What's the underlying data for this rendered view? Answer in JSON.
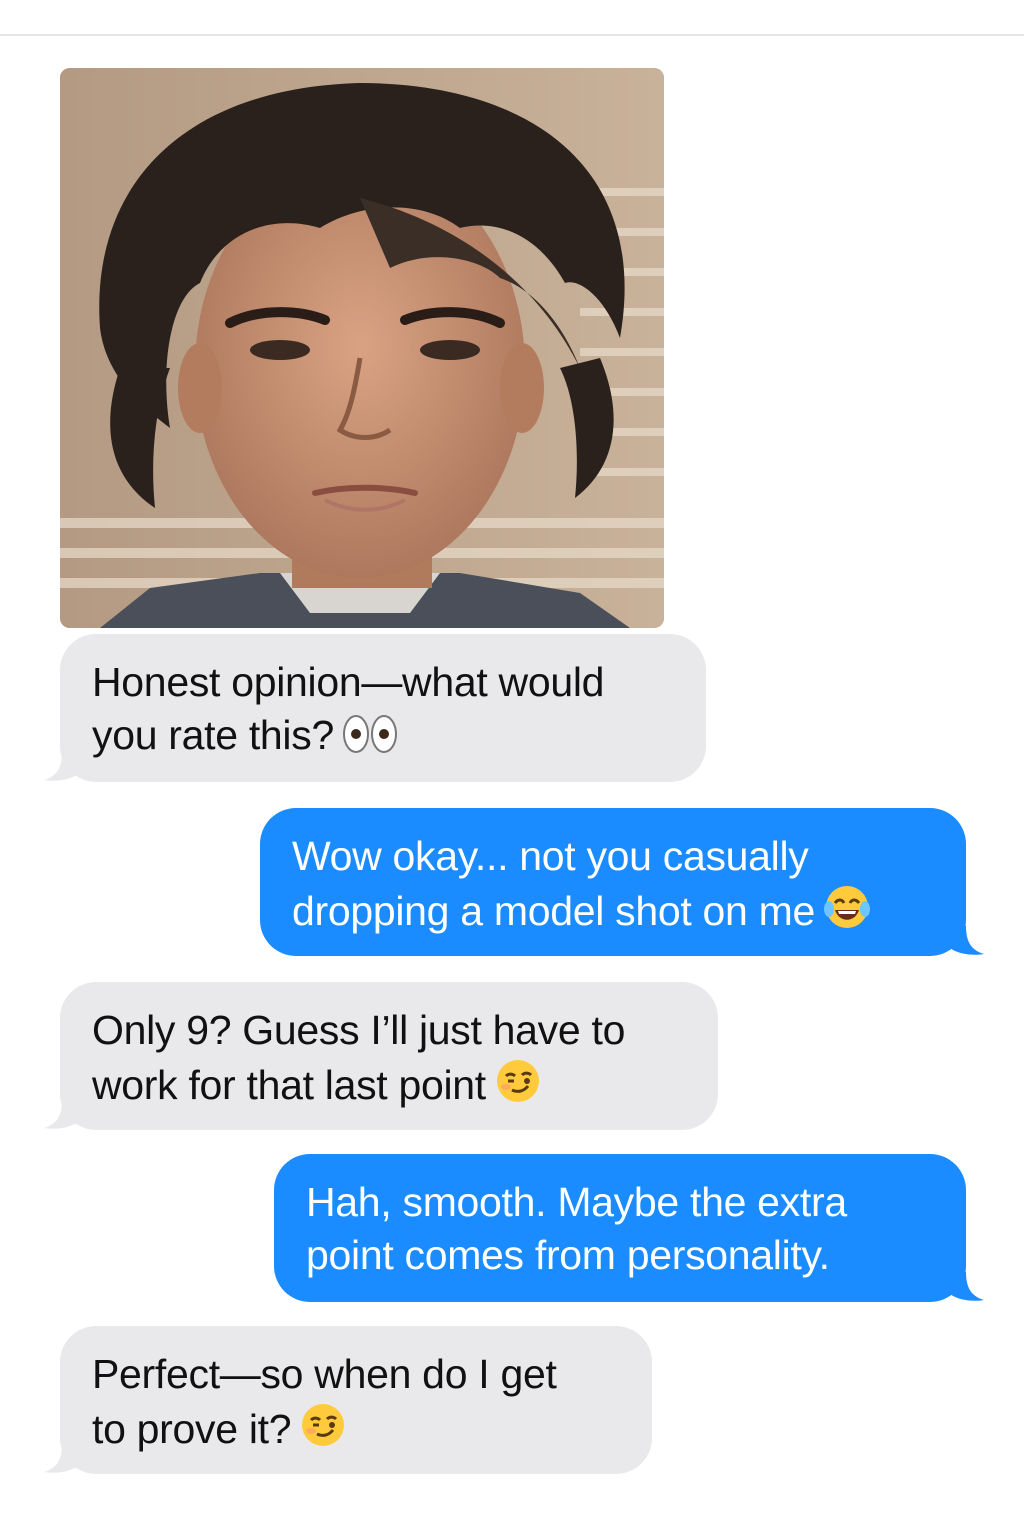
{
  "conversation": {
    "photo_attachment": {
      "description_icon": "portrait-photo-icon"
    },
    "messages": [
      {
        "direction": "received",
        "lines": [
          "Honest opinion—what would",
          "you rate this?"
        ],
        "emoji": "eyes-emoji"
      },
      {
        "direction": "sent",
        "lines": [
          "Wow okay... not you casually",
          "dropping a model shot on me"
        ],
        "emoji": "tears-of-joy-emoji"
      },
      {
        "direction": "received",
        "lines": [
          "Only 9? Guess I’ll just have to",
          "work for that last point"
        ],
        "emoji": "smirk-emoji"
      },
      {
        "direction": "sent",
        "lines": [
          "Hah, smooth. Maybe the extra",
          "point comes from personality."
        ]
      },
      {
        "direction": "received",
        "lines": [
          "Perfect—so when do I get",
          "to prove it?"
        ],
        "emoji": "smirk-emoji"
      }
    ]
  },
  "colors": {
    "received_bubble": "#e9e9eb",
    "sent_bubble": "#1a8cff",
    "received_text": "#111111",
    "sent_text": "#ffffff",
    "background": "#ffffff"
  }
}
